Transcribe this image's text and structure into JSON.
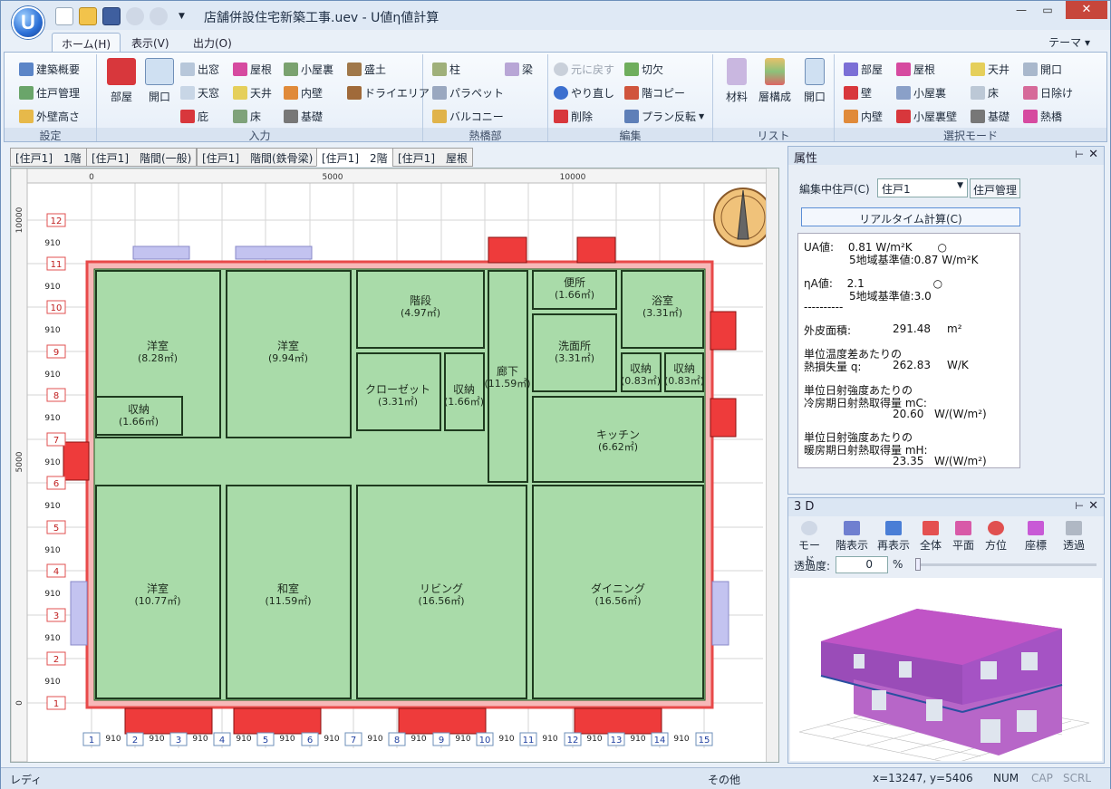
{
  "app": {
    "logo_letter": "U",
    "title": "店舗併設住宅新築工事.uev - U値η値計算",
    "close": "✕"
  },
  "menu_tabs": [
    "ホーム(H)",
    "表示(V)",
    "出力(O)"
  ],
  "theme": "テーマ",
  "ribbon": {
    "settings": {
      "label": "設定",
      "items": [
        "建築概要",
        "住戸管理",
        "外壁高さ"
      ]
    },
    "input": {
      "label": "入力",
      "big": [
        "部屋",
        "開口"
      ],
      "items": [
        "出窓",
        "屋根",
        "小屋裏",
        "盛土",
        "天窓",
        "天井",
        "内壁",
        "ドライエリア",
        "庇",
        "床",
        "基礎"
      ]
    },
    "thermal": {
      "label": "熱橋部",
      "items": [
        "柱",
        "梁",
        "パラペット",
        "バルコニー"
      ]
    },
    "edit": {
      "label": "編集",
      "items": [
        "元に戻す",
        "切欠",
        "やり直し",
        "階コピー",
        "削除",
        "プラン反転"
      ]
    },
    "list": {
      "label": "リスト",
      "big": [
        "材料",
        "層構成",
        "開口"
      ]
    },
    "select": {
      "label": "選択モード",
      "items": [
        "部屋",
        "屋根",
        "天井",
        "開口",
        "壁",
        "小屋裏",
        "床",
        "日除け",
        "内壁",
        "小屋裏壁",
        "基礎",
        "熱橋"
      ]
    }
  },
  "doc_tabs": [
    "[住戸1]　1階",
    "[住戸1]　階間(一般)",
    "[住戸1]　階間(鉄骨梁)",
    "[住戸1]　2階",
    "[住戸1]　屋根"
  ],
  "plan": {
    "ruler_top": [
      "0",
      "5000",
      "10000"
    ],
    "ruler_left": [
      "10000",
      "5000",
      "0"
    ],
    "row_labels": [
      "12",
      "11",
      "10",
      "9",
      "8",
      "7",
      "6",
      "5",
      "4",
      "3",
      "2",
      "1"
    ],
    "col_labels": [
      "1",
      "2",
      "3",
      "4",
      "5",
      "6",
      "7",
      "8",
      "9",
      "10",
      "11",
      "12",
      "13",
      "14",
      "15"
    ],
    "module": "910",
    "rooms": [
      {
        "name": "洋室",
        "area": "(8.28㎡)"
      },
      {
        "name": "洋室",
        "area": "(9.94㎡)"
      },
      {
        "name": "階段",
        "area": "(4.97㎡)"
      },
      {
        "name": "便所",
        "area": "(1.66㎡)"
      },
      {
        "name": "浴室",
        "area": "(3.31㎡)"
      },
      {
        "name": "洗面所",
        "area": "(3.31㎡)"
      },
      {
        "name": "クローゼット",
        "area": "(3.31㎡)"
      },
      {
        "name": "収納",
        "area": "(1.66㎡)"
      },
      {
        "name": "廊下",
        "area": "(11.59㎡)"
      },
      {
        "name": "収納",
        "area": "(0.83㎡)"
      },
      {
        "name": "収納",
        "area": "(0.83㎡)"
      },
      {
        "name": "収納",
        "area": "(1.66㎡)"
      },
      {
        "name": "キッチン",
        "area": "(6.62㎡)"
      },
      {
        "name": "収納",
        "area": "(1.66㎡)"
      },
      {
        "name": "収納",
        "area": "(0.83㎡)"
      },
      {
        "name": "洋室",
        "area": "(10.77㎡)"
      },
      {
        "name": "和室",
        "area": "(11.59㎡)"
      },
      {
        "name": "リビング",
        "area": "(16.56㎡)"
      },
      {
        "name": "ダイニング",
        "area": "(16.56㎡)"
      }
    ]
  },
  "props": {
    "title": "属性",
    "edit_unit_label": "編集中住戸(C)",
    "edit_unit_value": "住戸1",
    "unit_mgmt_button": "住戸管理",
    "realtime_button": "リアルタイム計算(C)",
    "results": {
      "ua": "UA値:　 0.81  W/m²K　　 ○",
      "ua_std": "5地域基準値:0.87  W/m²K",
      "eta": "ηA値:　 2.1　　　　　　 ○",
      "eta_std": "5地域基準値:3.0",
      "sep": "----------",
      "area_label": "外皮面積:",
      "area_value": "291.48",
      "area_unit": "m²",
      "q_title": "単位温度差あたりの",
      "q_label": "熱損失量  q:",
      "q_value": "262.83",
      "q_unit": "W/K",
      "mc_title1": "単位日射強度あたりの",
      "mc_title2": "冷房期日射熱取得量  mC:",
      "mc_value": "20.60",
      "mc_unit": "W/(W/m²)",
      "mh_title1": "単位日射強度あたりの",
      "mh_title2": "暖房期日射熱取得量  mH:",
      "mh_value": "23.35",
      "mh_unit": "W/(W/m²)"
    }
  },
  "view3d": {
    "title": "3 D",
    "tools": [
      "モード",
      "階表示",
      "再表示",
      "全体",
      "平面",
      "方位",
      "座標",
      "透過"
    ],
    "opacity_label": "透過度:",
    "opacity_value": "0",
    "opacity_unit": "%"
  },
  "status": {
    "ready": "レディ",
    "other": "その他",
    "coords": "x=13247, y=5406",
    "num": "NUM",
    "cap": "CAP",
    "scrl": "SCRL"
  },
  "colors": {
    "room_fill": "#a9dba9",
    "wall": "#e84a4a",
    "opening": "#ee3b3b",
    "accent": "#2b6fd6"
  }
}
